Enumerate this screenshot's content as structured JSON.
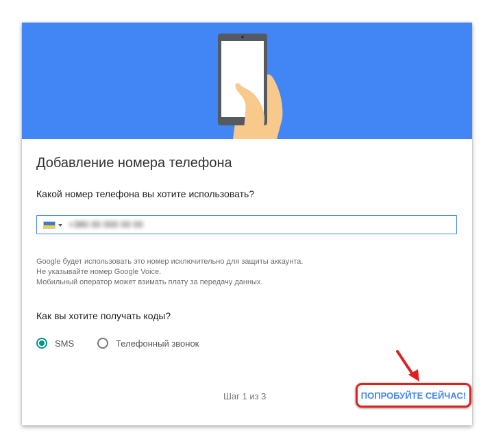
{
  "colors": {
    "banner": "#4285f4",
    "accent": "#4285f4",
    "radio_checked": "#009688",
    "annotation_red": "#e02020"
  },
  "dialog": {
    "title": "Добавление номера телефона",
    "phone_question": "Какой номер телефона вы хотите использовать?",
    "phone_field": {
      "country_flag": "ukraine-flag-icon",
      "value": "+380 00 000 00 00",
      "blurred": true
    },
    "note_lines": [
      "Google будет использовать это номер исключительно для защиты аккаунта.",
      "Не указывайте номер Google Voice.",
      "Мобильный оператор может взимать плату за передачу данных."
    ],
    "codes_question": "Как вы хотите получать коды?",
    "options": [
      {
        "label": "SMS",
        "checked": true
      },
      {
        "label": "Телефонный звонок",
        "checked": false
      }
    ],
    "step": "Шаг 1 из 3",
    "try_button": "ПОПРОБУЙТЕ СЕЙЧАС!"
  },
  "icons": {
    "banner_illustration": "hand-holding-phone-icon",
    "annotation_arrow": "red-arrow-icon"
  }
}
